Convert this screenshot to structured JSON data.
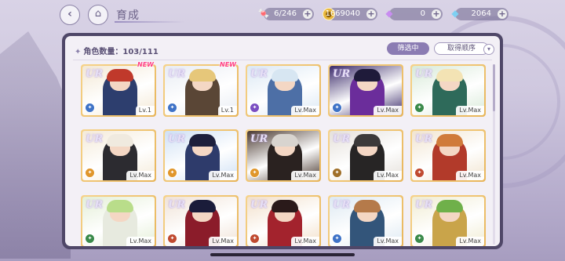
{
  "header": {
    "title": "育成",
    "back_icon": "chevron-left-icon",
    "home_icon": "castle-icon"
  },
  "resources": {
    "candy": {
      "icon": "candy-icon",
      "value": "6/246"
    },
    "coin": {
      "icon": "coin-icon",
      "value": "1669040"
    },
    "gem_purple": {
      "icon": "purple-diamond-icon",
      "value": "0"
    },
    "gem_blue": {
      "icon": "blue-diamond-icon",
      "value": "2064"
    }
  },
  "panel": {
    "count_label": "角色数量：103/111",
    "filter_label": "筛选中",
    "sort_label": "取得顺序",
    "sort_toggle_icon": "chevron-down-icon"
  },
  "cards": [
    {
      "rarity": "UR",
      "level": "Lv.1",
      "new": "NEW",
      "attr_color": "#3f73c7",
      "hair": "#c0392b",
      "outfit": "#2d3e6e",
      "bg": "#f3e8d4",
      "attr": "✦"
    },
    {
      "rarity": "UR",
      "level": "Lv.1",
      "new": "NEW",
      "attr_color": "#3f73c7",
      "hair": "#e6c77a",
      "outfit": "#5a4636",
      "bg": "#e8ecf3",
      "attr": "✦"
    },
    {
      "rarity": "UR",
      "level": "Lv.Max",
      "new": "",
      "attr_color": "#7b4fc2",
      "hair": "#d7e6f2",
      "outfit": "#4d6fa6",
      "bg": "#dbe8f4",
      "attr": "✦"
    },
    {
      "rarity": "UR",
      "level": "Lv.Max",
      "new": "",
      "attr_color": "#3f73c7",
      "hair": "#1f1b3a",
      "outfit": "#6b2d9b",
      "bg": "#3a2a6a",
      "attr": "✦"
    },
    {
      "rarity": "UR",
      "level": "Lv.Max",
      "new": "",
      "attr_color": "#3a8a4a",
      "hair": "#f3e3b4",
      "outfit": "#2e6a5a",
      "bg": "#d8ead8",
      "attr": "✦"
    },
    {
      "rarity": "UR",
      "level": "Lv.Max",
      "new": "",
      "attr_color": "#e0962b",
      "hair": "#f0eadf",
      "outfit": "#2c2b30",
      "bg": "#f4ead8",
      "attr": "✦"
    },
    {
      "rarity": "UR",
      "level": "Lv.Max",
      "new": "",
      "attr_color": "#e0962b",
      "hair": "#1d1f3c",
      "outfit": "#2e3b6b",
      "bg": "#cfe0f4",
      "attr": "✦"
    },
    {
      "rarity": "UR",
      "level": "Lv.Max",
      "new": "",
      "attr_color": "#e0962b",
      "hair": "#d8d4cf",
      "outfit": "#2a2220",
      "bg": "#4a3930",
      "attr": "✦"
    },
    {
      "rarity": "UR",
      "level": "Lv.Max",
      "new": "",
      "attr_color": "#a0702a",
      "hair": "#3c3a3a",
      "outfit": "#272525",
      "bg": "#e5e0da",
      "attr": "✦"
    },
    {
      "rarity": "UR",
      "level": "Lv.Max",
      "new": "",
      "attr_color": "#c04a30",
      "hair": "#d07b3a",
      "outfit": "#b23a2a",
      "bg": "#f1e4cf",
      "attr": "✦"
    },
    {
      "rarity": "UR",
      "level": "Lv.Max",
      "new": "",
      "attr_color": "#3a8a4a",
      "hair": "#b9dd8a",
      "outfit": "#e7eadf",
      "bg": "#e4efd7",
      "attr": "✦"
    },
    {
      "rarity": "UR",
      "level": "Lv.Max",
      "new": "",
      "attr_color": "#c04a30",
      "hair": "#1a1c3a",
      "outfit": "#8b1c2a",
      "bg": "#f0e2d6",
      "attr": "✦"
    },
    {
      "rarity": "UR",
      "level": "Lv.Max",
      "new": "",
      "attr_color": "#c04a30",
      "hair": "#2a1a1a",
      "outfit": "#a3232d",
      "bg": "#f2dfc9",
      "attr": "✦"
    },
    {
      "rarity": "UR",
      "level": "Lv.Max",
      "new": "",
      "attr_color": "#3f73c7",
      "hair": "#b57a4a",
      "outfit": "#33557a",
      "bg": "#dde9f2",
      "attr": "✦"
    },
    {
      "rarity": "UR",
      "level": "Lv.Max",
      "new": "",
      "attr_color": "#3a8a4a",
      "hair": "#6fb04a",
      "outfit": "#c9a44a",
      "bg": "#f0ecd2",
      "attr": "✦"
    }
  ]
}
